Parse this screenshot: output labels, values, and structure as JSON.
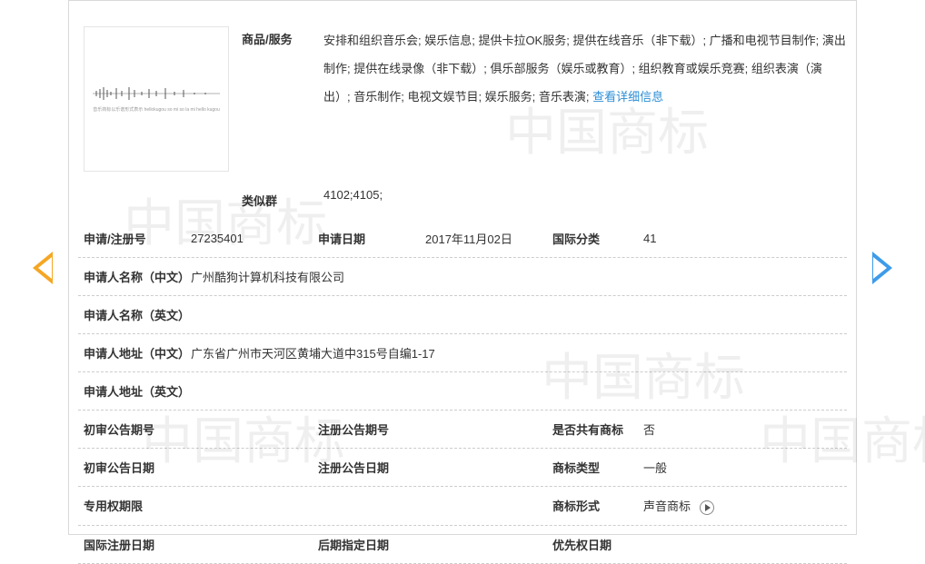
{
  "goods": {
    "label": "商品/服务",
    "value": "安排和组织音乐会; 娱乐信息; 提供卡拉OK服务; 提供在线音乐（非下载）; 广播和电视节目制作; 演出制作; 提供在线录像（非下载）; 俱乐部服务（娱乐或教育）; 组织教育或娱乐竞赛; 组织表演（演出）; 音乐制作; 电视文娱节目; 娱乐服务; 音乐表演; ",
    "link": "查看详细信息"
  },
  "similar": {
    "label": "类似群",
    "value": "4102;4105;"
  },
  "fields": {
    "reg_no": {
      "label": "申请/注册号",
      "value": "27235401"
    },
    "app_date": {
      "label": "申请日期",
      "value": "2017年11月02日"
    },
    "intl_class": {
      "label": "国际分类",
      "value": "41"
    },
    "app_name_cn": {
      "label": "申请人名称（中文）",
      "value": "广州酷狗计算机科技有限公司"
    },
    "app_name_en": {
      "label": "申请人名称（英文）",
      "value": ""
    },
    "app_addr_cn": {
      "label": "申请人地址（中文）",
      "value": "广东省广州市天河区黄埔大道中315号自编1-17"
    },
    "app_addr_en": {
      "label": "申请人地址（英文）",
      "value": ""
    },
    "prelim_no": {
      "label": "初审公告期号",
      "value": ""
    },
    "reg_pub_no": {
      "label": "注册公告期号",
      "value": ""
    },
    "shared": {
      "label": "是否共有商标",
      "value": "否"
    },
    "prelim_date": {
      "label": "初审公告日期",
      "value": ""
    },
    "reg_pub_date": {
      "label": "注册公告日期",
      "value": ""
    },
    "tm_type": {
      "label": "商标类型",
      "value": "一般"
    },
    "excl_period": {
      "label": "专用权期限",
      "value": ""
    },
    "tm_form": {
      "label": "商标形式",
      "value": "声音商标"
    },
    "intl_reg_date": {
      "label": "国际注册日期",
      "value": ""
    },
    "later_date": {
      "label": "后期指定日期",
      "value": ""
    },
    "priority_date": {
      "label": "优先权日期",
      "value": ""
    }
  },
  "watermark": "中国商标"
}
